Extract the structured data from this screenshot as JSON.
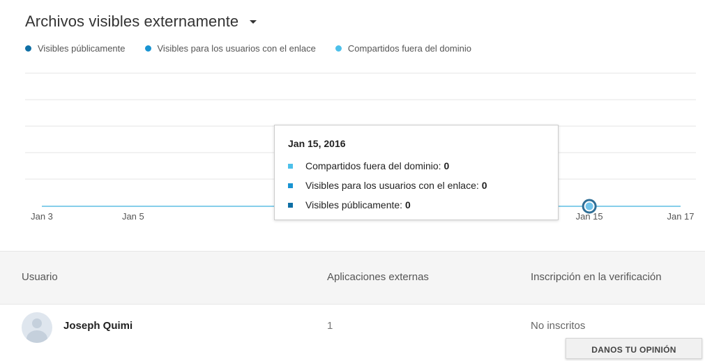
{
  "header": {
    "title": "Archivos visibles externamente"
  },
  "colors": {
    "publicly_visible": "#0f6fa5",
    "visible_with_link": "#1994d2",
    "shared_outside_domain": "#4dc0ea",
    "line": "#7fcbe9",
    "grid": "#e5e5e5"
  },
  "legend": [
    {
      "label": "Visibles públicamente",
      "color": "#0f6fa5"
    },
    {
      "label": "Visibles para los usuarios con el enlace",
      "color": "#1994d2"
    },
    {
      "label": "Compartidos fuera del dominio",
      "color": "#4dc0ea"
    }
  ],
  "chart_data": {
    "type": "line",
    "title": "Archivos visibles externamente",
    "x": [
      "2016-01-03",
      "2016-01-04",
      "2016-01-05",
      "2016-01-06",
      "2016-01-07",
      "2016-01-08",
      "2016-01-09",
      "2016-01-10",
      "2016-01-11",
      "2016-01-12",
      "2016-01-13",
      "2016-01-14",
      "2016-01-15",
      "2016-01-16",
      "2016-01-17"
    ],
    "series": [
      {
        "name": "Visibles públicamente",
        "color": "#0f6fa5",
        "values": [
          0,
          0,
          0,
          0,
          0,
          0,
          0,
          0,
          0,
          0,
          0,
          0,
          0,
          0,
          0
        ]
      },
      {
        "name": "Visibles para los usuarios con el enlace",
        "color": "#1994d2",
        "values": [
          0,
          0,
          0,
          0,
          0,
          0,
          0,
          0,
          0,
          0,
          0,
          0,
          0,
          0,
          0
        ]
      },
      {
        "name": "Compartidos fuera del dominio",
        "color": "#4dc0ea",
        "values": [
          0,
          0,
          0,
          0,
          0,
          0,
          0,
          0,
          0,
          0,
          0,
          0,
          0,
          0,
          0
        ]
      }
    ],
    "visible_tick_labels": [
      {
        "label": "Jan 3",
        "date": "2016-01-03"
      },
      {
        "label": "Jan 5",
        "date": "2016-01-05"
      },
      {
        "label": "Jan 15",
        "date": "2016-01-15"
      },
      {
        "label": "Jan 17",
        "date": "2016-01-17"
      }
    ],
    "highlighted_date": "2016-01-15",
    "grid": true
  },
  "tooltip": {
    "date": "Jan 15, 2016",
    "rows": [
      {
        "label": "Compartidos fuera del dominio:",
        "value": "0",
        "color": "#4dc0ea"
      },
      {
        "label": "Visibles para los usuarios con el enlace:",
        "value": "0",
        "color": "#1994d2"
      },
      {
        "label": "Visibles públicamente:",
        "value": "0",
        "color": "#0f6fa5"
      }
    ]
  },
  "table": {
    "columns": [
      "Usuario",
      "Aplicaciones externas",
      "Inscripción en la verificación"
    ],
    "rows": [
      {
        "user": "Joseph Quimi",
        "apps": "1",
        "enrollment": "No inscritos"
      }
    ]
  },
  "feedback_button": "DANOS TU OPINIÓN"
}
